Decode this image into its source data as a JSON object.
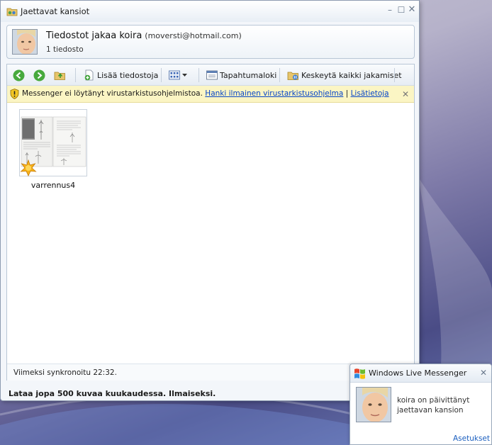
{
  "window": {
    "title": "Jaettavat kansiot"
  },
  "header": {
    "title": "Tiedostot jakaa koira",
    "email": "(moversti@hotmail.com)",
    "subtitle": "1 tiedosto"
  },
  "toolbar": {
    "back_icon": "arrow-left-icon",
    "forward_icon": "arrow-right-icon",
    "up_folder_icon": "folder-up-icon",
    "add_files_label": "Lisää tiedostoja",
    "view_icon": "view-grid-icon",
    "event_log_label": "Tapahtumaloki",
    "pause_sharing_label": "Keskeytä kaikki jakamiset"
  },
  "infobar": {
    "message": "Messenger ei löytänyt virustarkistusohjelmistoa.",
    "link_free": "Hanki ilmainen virustarkistusohjelma",
    "separator": "|",
    "link_more": "Lisätietoja"
  },
  "files": [
    {
      "name": "varrennus4",
      "badge": "new-star-icon"
    }
  ],
  "status": {
    "last_sync": "Viimeksi synkronoitu 22:32."
  },
  "promo": {
    "text": "Lataa jopa 500 kuvaa kuukaudessa. Ilmaiseksi."
  },
  "notification": {
    "app_title": "Windows Live Messenger",
    "message": "koira on päivittänyt jaettavan kansion",
    "settings_link": "Asetukset"
  },
  "colors": {
    "accent_link": "#0645c8",
    "infobar_bg": "#fbf5c4",
    "window_bg": "#f3f6fa"
  }
}
